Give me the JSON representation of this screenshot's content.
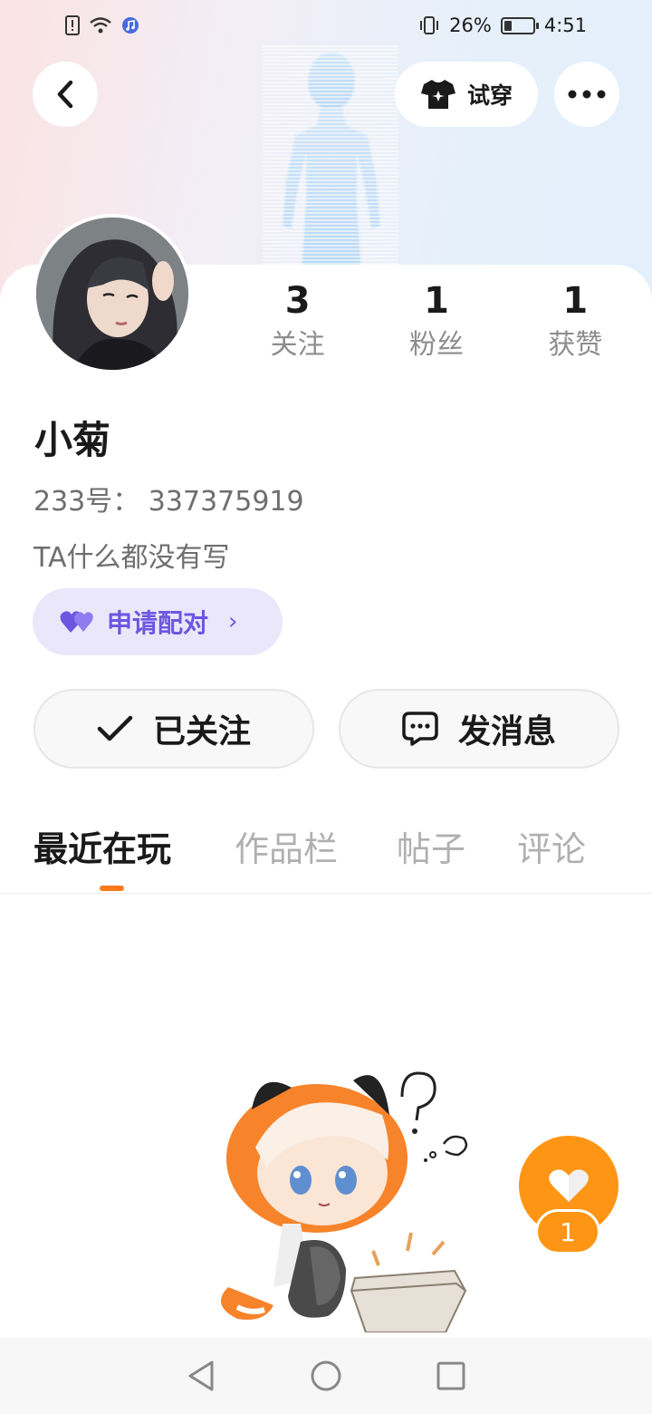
{
  "status_bar": {
    "battery_percent": "26%",
    "battery_level": 0.26,
    "time": "4:51"
  },
  "header": {
    "try_on_label": "试穿"
  },
  "profile": {
    "name": "小菊",
    "uid": "233号：  337375919",
    "bio": "TA什么都没有写",
    "stats": [
      {
        "value": "3",
        "label": "关注"
      },
      {
        "value": "1",
        "label": "粉丝"
      },
      {
        "value": "1",
        "label": "获赞"
      }
    ],
    "pair_label": "申请配对",
    "followed_label": "已关注",
    "message_label": "发消息"
  },
  "tabs": [
    {
      "label": "最近在玩",
      "active": true
    },
    {
      "label": "作品栏",
      "active": false
    },
    {
      "label": "帖子",
      "active": false
    },
    {
      "label": "评论",
      "active": false
    }
  ],
  "like_fab": {
    "count": "1"
  },
  "colors": {
    "accent": "#ff7a1a",
    "pair_bg": "#ebe7fb",
    "pair_text": "#6d56e0",
    "like": "#ff9514"
  }
}
